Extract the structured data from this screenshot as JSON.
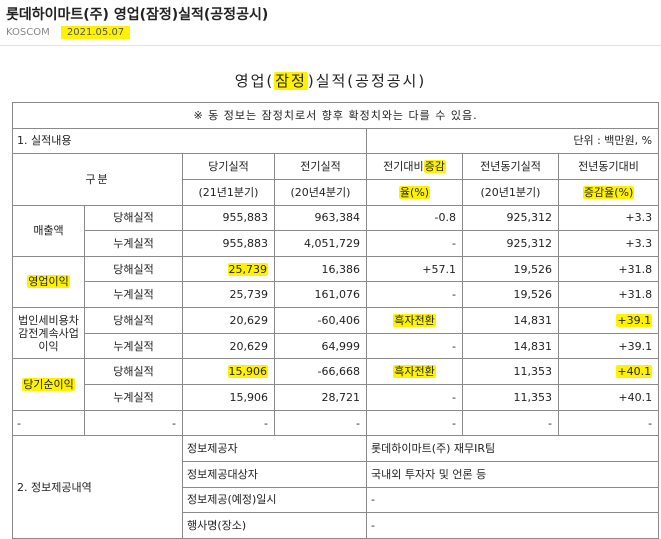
{
  "header": {
    "title": "롯데하이마트(주) 영업(잠정)실적(공정공시)",
    "source": "KOSCOM",
    "date": "2021.05.07"
  },
  "doc": {
    "title_pre": "영업(",
    "title_hl": "잠정",
    "title_post": ")실적(공정공시)",
    "notice": "※ 동 정보는 잠정치로서 향후 확정치와는 다를 수 있음."
  },
  "section1": {
    "label": "1. 실적내용",
    "unit": "단위 : 백만원, %"
  },
  "columns": {
    "category": "구분",
    "current": "당기실적",
    "current_sub": "(21년1분기)",
    "previous": "전기실적",
    "previous_sub": "(20년4분기)",
    "qoq_a": "전기대비",
    "qoq_hl1": "증감",
    "qoq_hl2": "율(%)",
    "yoy_base": "전년동기실적",
    "yoy_base_sub": "(20년1분기)",
    "yoy": "전년동기대비",
    "yoy_hl": "증감율(%)"
  },
  "groups": [
    {
      "name_lines": [
        "매출액"
      ],
      "highlight": false,
      "rows": [
        {
          "type": "당해실적",
          "current": "955,883",
          "previous": "963,384",
          "qoq": "-0.8",
          "yoy_base": "925,312",
          "yoy": "+3.3"
        },
        {
          "type": "누계실적",
          "current": "955,883",
          "previous": "4,051,729",
          "qoq": "-",
          "yoy_base": "925,312",
          "yoy": "+3.3"
        }
      ]
    },
    {
      "name_lines": [
        "영업이익"
      ],
      "highlight": true,
      "rows": [
        {
          "type": "당해실적",
          "current": "25,739",
          "previous": "16,386",
          "qoq": "+57.1",
          "yoy_base": "19,526",
          "yoy": "+31.8"
        },
        {
          "type": "누계실적",
          "current": "25,739",
          "previous": "161,076",
          "qoq": "-",
          "yoy_base": "19,526",
          "yoy": "+31.8"
        }
      ]
    },
    {
      "name_lines": [
        "법인세비용차",
        "감전계속사업",
        "이익"
      ],
      "highlight": false,
      "rows": [
        {
          "type": "당해실적",
          "current": "20,629",
          "previous": "-60,406",
          "qoq": "흑자전환",
          "yoy_base": "14,831",
          "yoy": "+39.1"
        },
        {
          "type": "누계실적",
          "current": "20,629",
          "previous": "64,999",
          "qoq": "-",
          "yoy_base": "14,831",
          "yoy": "+39.1"
        }
      ]
    },
    {
      "name_lines": [
        "당기순이익"
      ],
      "highlight": true,
      "rows": [
        {
          "type": "당해실적",
          "current": "15,906",
          "previous": "-66,668",
          "qoq": "흑자전환",
          "yoy_base": "11,353",
          "yoy": "+40.1"
        },
        {
          "type": "누계실적",
          "current": "15,906",
          "previous": "28,721",
          "qoq": "-",
          "yoy_base": "11,353",
          "yoy": "+40.1"
        }
      ]
    }
  ],
  "empty_row": {
    "category": "-",
    "cells": [
      "-",
      "-",
      "-",
      "-",
      "-",
      "-"
    ]
  },
  "section2": {
    "label": "2. 정보제공내역",
    "rows": [
      {
        "label": "정보제공자",
        "value": "롯데하이마트(주) 재무IR팀"
      },
      {
        "label": "정보제공대상자",
        "value": "국내외 투자자 및 언론 등"
      },
      {
        "label": "정보제공(예정)일시",
        "value": "-"
      },
      {
        "label": "행사명(장소)",
        "value": "-"
      }
    ]
  }
}
